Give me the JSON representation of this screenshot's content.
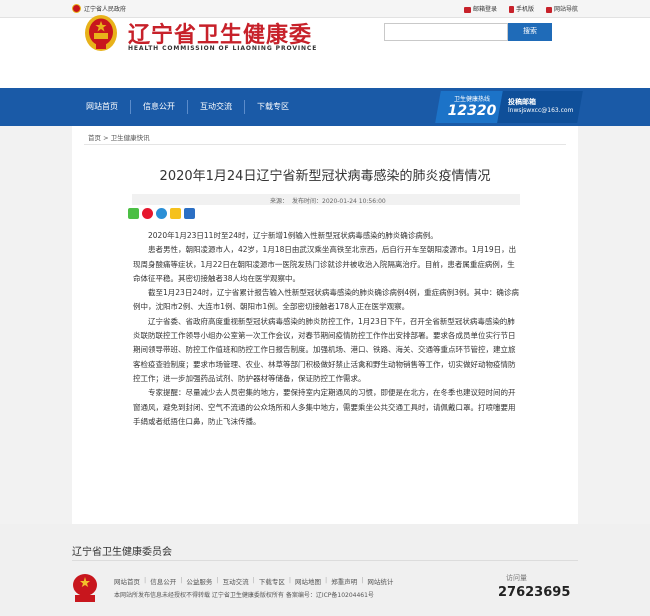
{
  "topbar": {
    "gov_link": "辽宁省人民政府",
    "mail_login": "邮箱登录",
    "mobile": "手机版",
    "site_nav": "网站导航"
  },
  "header": {
    "title": "辽宁省卫生健康委",
    "subtitle": "HEALTH COMMISSION OF LIAONING PROVINCE",
    "search_placeholder": "",
    "search_button": "搜索"
  },
  "nav": {
    "items": [
      {
        "label": "网站首页"
      },
      {
        "label": "信息公开"
      },
      {
        "label": "互动交流"
      },
      {
        "label": "下载专区"
      }
    ],
    "hotline_label": "卫生健康热线",
    "hotline_number": "12320",
    "mail_label": "投稿邮箱",
    "mail_address": "lnwsjswxcc@163.com"
  },
  "breadcrumb": "首页 > 卫生健康快讯",
  "article": {
    "title": "2020年1月24日辽宁省新型冠状病毒感染的肺炎疫情情况",
    "source_label": "来源：",
    "publish_label": "发布时间：2020-01-24 10:56:00",
    "paragraphs": [
      "2020年1月23日11时至24时，辽宁新增1例输入性新型冠状病毒感染的肺炎确诊病例。",
      "患者男性，朝阳凌源市人，42岁，1月18日由武汉乘坐高铁至北京西，后自行开车至朝阳凌源市。1月19日，出现周身酸痛等症状，1月22日在朝阳凌源市一医院发热门诊就诊并被收治入院隔离治疗。目前，患者属重症病例，生命体征平稳。其密切接触者38人均在医学观察中。",
      "截至1月23日24时，辽宁省累计报告输入性新型冠状病毒感染的肺炎确诊病例4例，重症病例3例。其中：确诊病例中，沈阳市2例、大连市1例、朝阳市1例。全部密切接触者178人正在医学观察。",
      "辽宁省委、省政府高度重视新型冠状病毒感染的肺炎防控工作，1月23日下午，召开全省新型冠状病毒感染的肺炎联防联控工作领导小组办公室第一次工作会议，对春节期间疫情防控工作作出安排部署。要求各成员单位实行节日期间领导带班、防控工作值班和防控工作日报告制度。加强机场、港口、铁路、海关、交通等重点环节管控，建立旅客检疫查验制度；要求市场管理、农业、林草等部门积极做好禁止活禽和野生动物销售等工作，切实做好动物疫情防控工作；进一步加强药品试剂、防护器材等储备，保证防控工作需求。",
      "专家提醒：尽量减少去人员密集的地方，要保持室内定期通风的习惯，即便是在北方，在冬季也建议短时间的开窗通风，避免到封闭、空气不流通的公众场所和人多集中地方，需要乘坐公共交通工具时，请佩戴口罩。打喷嚏要用手绢或者纸捂住口鼻，防止飞沫传播。"
    ]
  },
  "footer": {
    "title": "辽宁省卫生健康委员会",
    "links": [
      "网站首页",
      "信息公开",
      "公益服务",
      "互动交流",
      "下载专区",
      "网站地图",
      "郑重声明",
      "网站统计"
    ],
    "copyright": "本网站所发布信息未经授权不得转载  辽宁省卫生健康委版权所有  备案编号：辽ICP备10204461号",
    "counter_label": "访问量",
    "counter_value": "27623695",
    "badge_text": "党政机关"
  },
  "colors": {
    "brand_red": "#c7212a",
    "nav_blue": "#1a5aa7"
  }
}
